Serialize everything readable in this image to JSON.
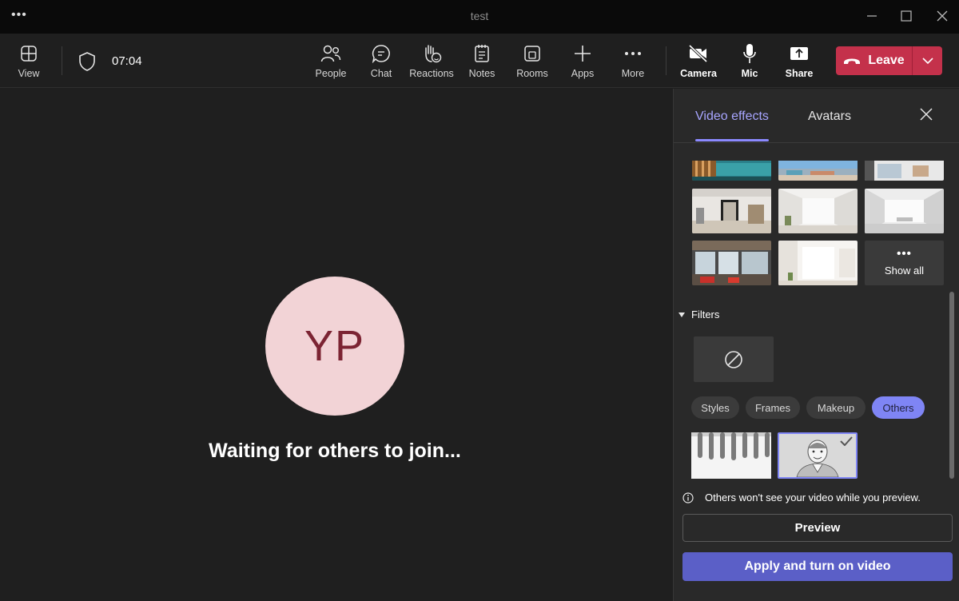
{
  "window": {
    "title": "test"
  },
  "toolbar": {
    "view_label": "View",
    "timer": "07:04",
    "people_label": "People",
    "chat_label": "Chat",
    "reactions_label": "Reactions",
    "notes_label": "Notes",
    "rooms_label": "Rooms",
    "apps_label": "Apps",
    "more_label": "More",
    "camera_label": "Camera",
    "mic_label": "Mic",
    "share_label": "Share",
    "leave_label": "Leave"
  },
  "stage": {
    "avatar_initials": "YP",
    "waiting_text": "Waiting for others to join..."
  },
  "panel": {
    "tabs": [
      {
        "label": "Video effects",
        "active": true
      },
      {
        "label": "Avatars",
        "active": false
      }
    ],
    "show_all_label": "Show all",
    "filters_label": "Filters",
    "chips": [
      {
        "label": "Styles",
        "active": false
      },
      {
        "label": "Frames",
        "active": false
      },
      {
        "label": "Makeup",
        "active": false
      },
      {
        "label": "Others",
        "active": true
      }
    ],
    "info_text": "Others won't see your video while you preview.",
    "preview_label": "Preview",
    "apply_label": "Apply and turn on video"
  },
  "colors": {
    "accent": "#5b5fc7",
    "accent_light": "#7f85f5",
    "leave": "#c4314b",
    "avatar_bg": "#f2d3d6",
    "avatar_text": "#7c2433"
  }
}
